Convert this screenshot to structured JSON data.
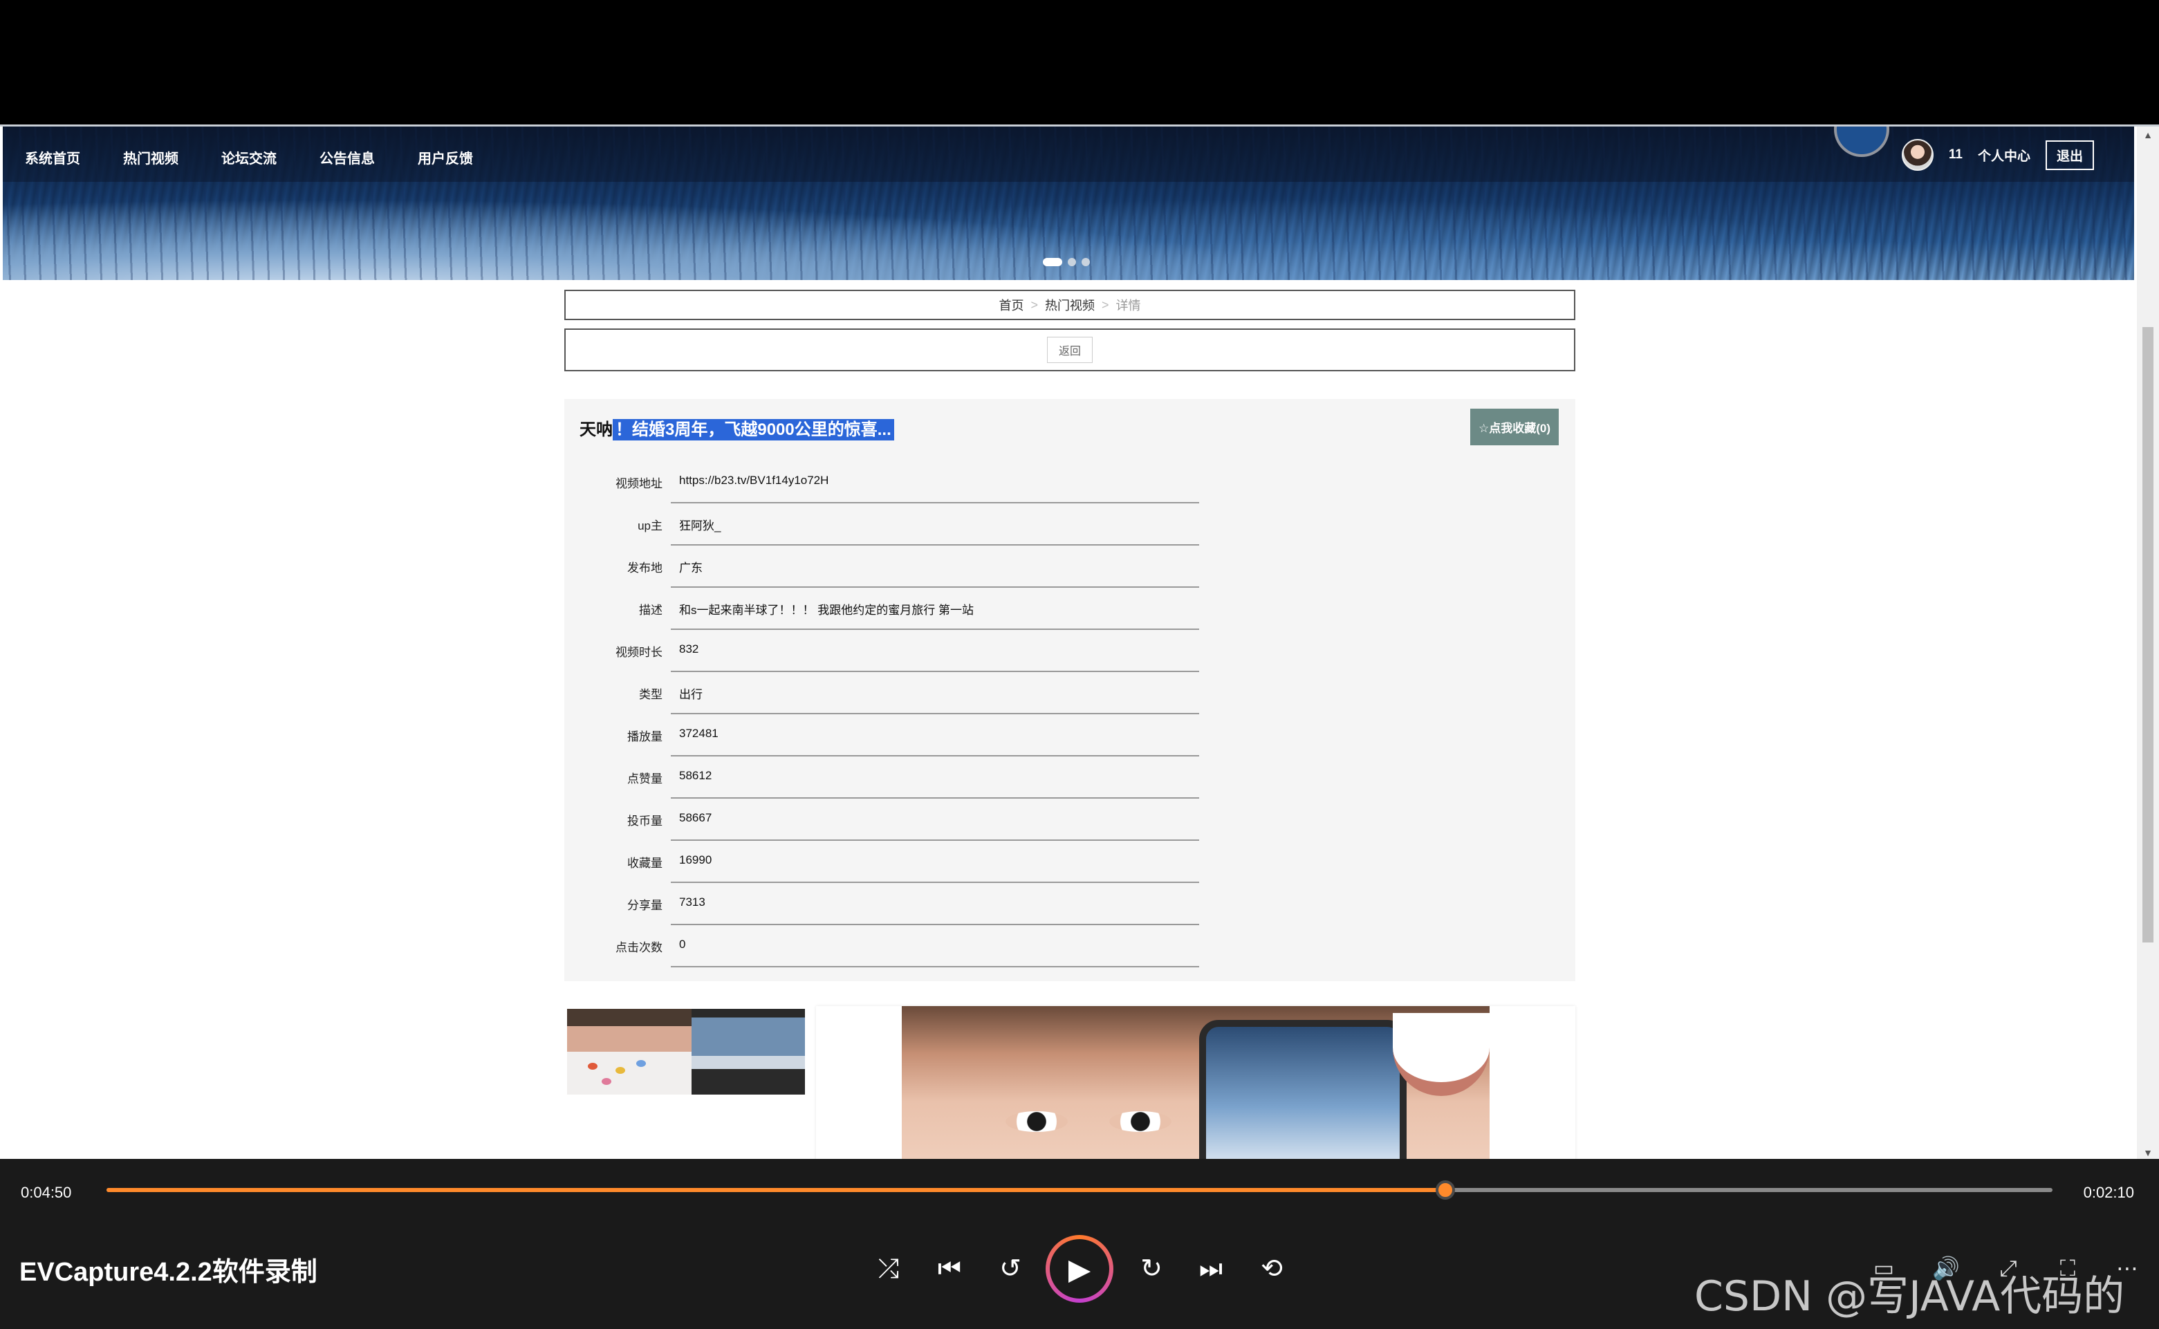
{
  "nav": {
    "items": [
      "系统首页",
      "热门视频",
      "论坛交流",
      "公告信息",
      "用户反馈"
    ],
    "user_id": "11",
    "personal_center": "个人中心",
    "logout": "退出"
  },
  "breadcrumb": {
    "home": "首页",
    "section": "热门视频",
    "current": "详情",
    "separator": ">"
  },
  "back_button": "返回",
  "detail": {
    "title_prefix": "天呐",
    "title_highlight": "！结婚3周年，飞越9000公里的惊喜...",
    "favorite_button": "☆点我收藏(0)",
    "fields": [
      {
        "label": "视频地址",
        "value": "https://b23.tv/BV1f14y1o72H"
      },
      {
        "label": "up主",
        "value": "狂阿狄_"
      },
      {
        "label": "发布地",
        "value": "广东"
      },
      {
        "label": "描述",
        "value": "和s一起来南半球了！！！ 我跟他约定的蜜月旅行 第一站"
      },
      {
        "label": "视频时长",
        "value": "832"
      },
      {
        "label": "类型",
        "value": "出行"
      },
      {
        "label": "播放量",
        "value": "372481"
      },
      {
        "label": "点赞量",
        "value": "58612"
      },
      {
        "label": "投币量",
        "value": "58667"
      },
      {
        "label": "收藏量",
        "value": "16990"
      },
      {
        "label": "分享量",
        "value": "7313"
      },
      {
        "label": "点击次数",
        "value": "0"
      }
    ]
  },
  "player": {
    "current_time": "0:04:50",
    "total_time": "0:02:10",
    "progress_fraction": 0.688,
    "title": "EVCapture4.2.2软件录制",
    "accent_color": "#ff8a2b"
  },
  "watermark": "CSDN @写JAVA代码的人"
}
